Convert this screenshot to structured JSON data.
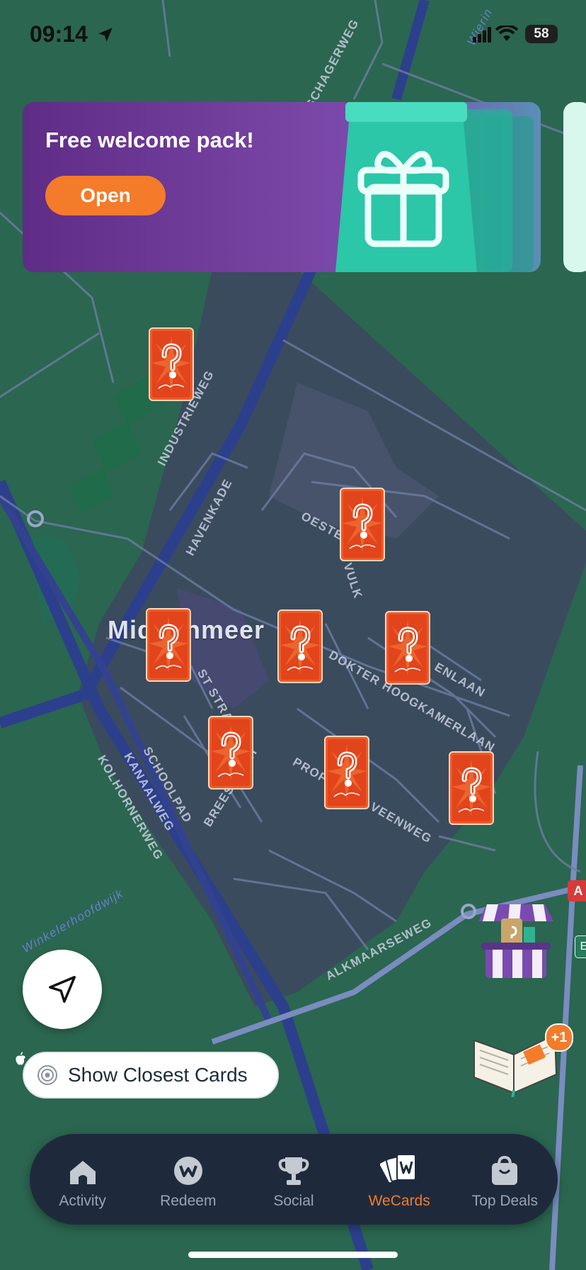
{
  "status_bar": {
    "time": "09:14",
    "battery": "58"
  },
  "banner": {
    "title": "Free welcome pack!",
    "button_label": "Open"
  },
  "map": {
    "town": "Middenmeer",
    "streets": [
      "SCHAGERWEG",
      "INDUSTRIEWEG",
      "HAVENKADE",
      "OESTER",
      "VULK",
      "DOKTER HOOGKAMERLAAN",
      "ENLAAN",
      "ST STRA",
      "SCHOOLPAD",
      "BREESTRAAT",
      "KANAALWEG",
      "KOLHORNERWEG",
      "PROFESSOR VEENWEG",
      "ALKMAARSEWEG",
      "Winkelerhoofdwijk",
      "Wierin"
    ],
    "road_sign_a": "A",
    "road_sign_b": "E",
    "card_count": 8
  },
  "buttons": {
    "show_closest": "Show Closest Cards"
  },
  "guide": {
    "badge": "+1"
  },
  "tabs": [
    {
      "label": "Activity",
      "icon": "home-icon"
    },
    {
      "label": "Redeem",
      "icon": "w-coin-icon"
    },
    {
      "label": "Social",
      "icon": "trophy-icon"
    },
    {
      "label": "WeCards",
      "icon": "cards-icon",
      "active": true
    },
    {
      "label": "Top Deals",
      "icon": "shopping-bag-icon"
    }
  ],
  "colors": {
    "accent": "#f47b2a",
    "map_green": "#2b6650",
    "town_area": "#3a4a5c",
    "road": "#2c3f8c",
    "tabbar": "#1e2a3c"
  }
}
